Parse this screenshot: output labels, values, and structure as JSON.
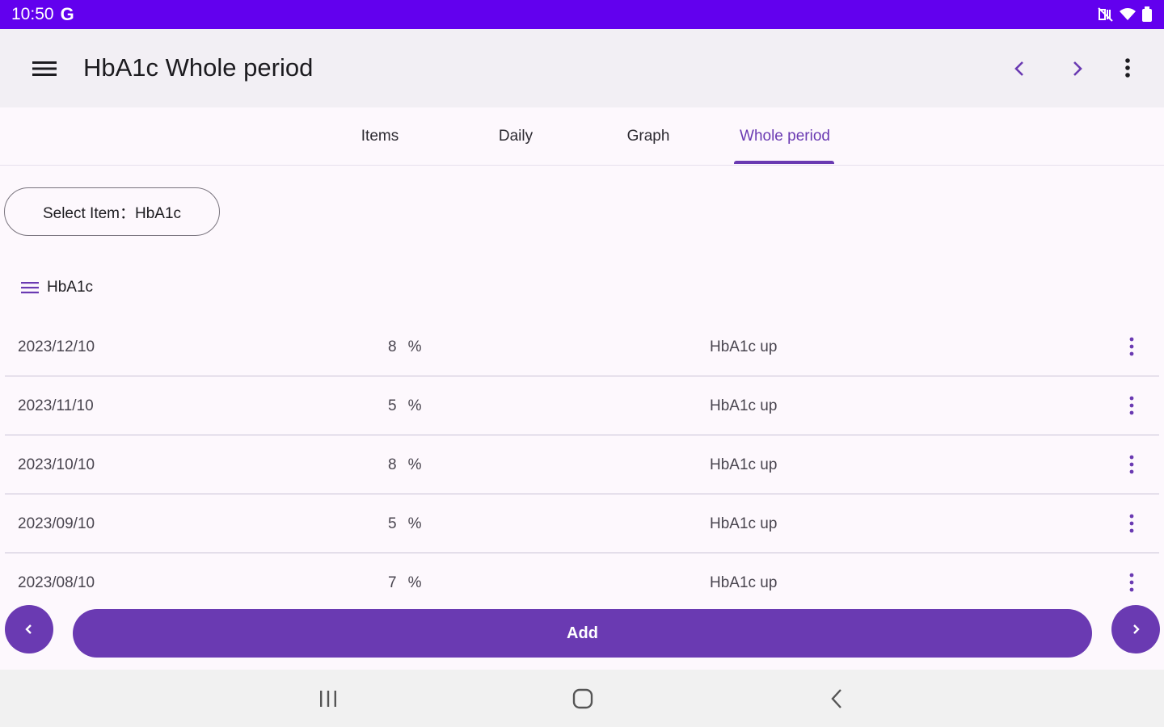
{
  "status_bar": {
    "time": "10:50",
    "carrier_icon": "G",
    "icons": [
      "mute-vibrate-icon",
      "wifi-icon",
      "battery-icon"
    ]
  },
  "app_bar": {
    "title": "HbA1c Whole period",
    "icons": [
      "menu-icon",
      "chevron-left-icon",
      "chevron-right-icon",
      "more-vert-icon"
    ]
  },
  "tabs": [
    {
      "label": "Items",
      "active": false
    },
    {
      "label": "Daily",
      "active": false
    },
    {
      "label": "Graph",
      "active": false
    },
    {
      "label": "Whole period",
      "active": true
    }
  ],
  "select_item": {
    "label": "Select Item：HbA1c"
  },
  "section": {
    "label": "HbA1c",
    "icon": "list-icon"
  },
  "rows": [
    {
      "date": "2023/12/10",
      "value": "8",
      "unit": "%",
      "memo": "HbA1c up"
    },
    {
      "date": "2023/11/10",
      "value": "5",
      "unit": "%",
      "memo": "HbA1c up"
    },
    {
      "date": "2023/10/10",
      "value": "8",
      "unit": "%",
      "memo": "HbA1c up"
    },
    {
      "date": "2023/09/10",
      "value": "5",
      "unit": "%",
      "memo": "HbA1c up"
    },
    {
      "date": "2023/08/10",
      "value": "7",
      "unit": "%",
      "memo": "HbA1c up"
    }
  ],
  "actions": {
    "add_label": "Add"
  },
  "colors": {
    "status_bar": "#6200ee",
    "accent": "#6a3ab2",
    "app_bar_bg": "#f2eff4",
    "divider": "#c9c2d6"
  },
  "system_nav": [
    "recent-apps-icon",
    "home-icon",
    "back-icon"
  ]
}
